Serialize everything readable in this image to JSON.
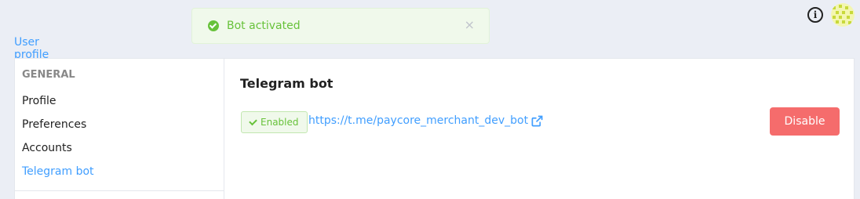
{
  "toast": {
    "message": "Bot activated",
    "close_symbol": "×",
    "icon": "check-circle-icon"
  },
  "header": {
    "info_symbol": "i"
  },
  "tabs": [
    {
      "label": "User profile",
      "active": true
    }
  ],
  "sidebar": {
    "heading": "GENERAL",
    "items": [
      {
        "label": "Profile"
      },
      {
        "label": "Preferences"
      },
      {
        "label": "Accounts"
      },
      {
        "label": "Telegram bot",
        "active": true
      }
    ]
  },
  "main": {
    "title": "Telegram bot",
    "status_badge": "Enabled",
    "bot_link": "https://t.me/paycore_merchant_dev_bot",
    "disable_label": "Disable"
  },
  "colors": {
    "accent": "#409eff",
    "success": "#67c23a",
    "danger": "#f56c6c",
    "background": "#ebeef5"
  }
}
